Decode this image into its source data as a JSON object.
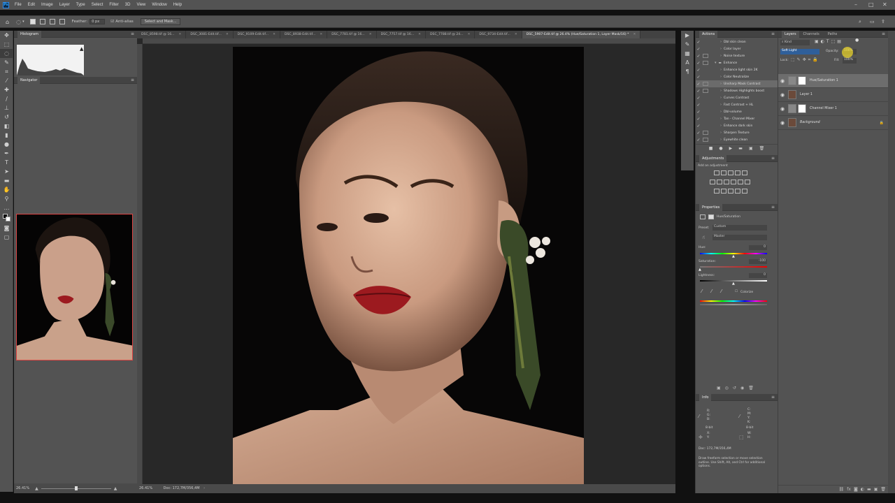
{
  "app": {
    "logo": "Ps",
    "menu": [
      "File",
      "Edit",
      "Image",
      "Layer",
      "Type",
      "Select",
      "Filter",
      "3D",
      "View",
      "Window",
      "Help"
    ],
    "window_controls": [
      "–",
      "□",
      "✕"
    ]
  },
  "options_bar": {
    "feather_label": "Feather:",
    "feather_value": "0 px",
    "antialias_label": "Anti-alias",
    "select_mask_button": "Select and Mask..."
  },
  "left_panels": {
    "histogram_tab": "Histogram",
    "navigator_tab": "Navigator",
    "zoom_value": "26.41%"
  },
  "doc_tabs": [
    {
      "label": "DSC_8598.tif @ 16...",
      "active": false
    },
    {
      "label": "DSC_3081-Edit.tif...",
      "active": false
    },
    {
      "label": "DSC_9109-Edit.tif...",
      "active": false
    },
    {
      "label": "DSC_8938-Edit.tif...",
      "active": false
    },
    {
      "label": "DSC_7781.tif @ 16...",
      "active": false
    },
    {
      "label": "DSC_7757.tif @ 16...",
      "active": false
    },
    {
      "label": "DSC_7788.tif @ 24...",
      "active": false
    },
    {
      "label": "DSC_9734-Edit.tif...",
      "active": false
    },
    {
      "label": "DSC_5907-Edit.tif @ 26.4% (Hue/Saturation 1, Layer Mask/16) *",
      "active": true
    }
  ],
  "status": {
    "zoom": "26.41%",
    "doc_size": "Doc: 172,7M/356,4M"
  },
  "actions_panel": {
    "title": "Actions",
    "rows": [
      {
        "label": "Dbl skin clean",
        "checked": true,
        "dialog": false,
        "selected": false
      },
      {
        "label": "Color layer",
        "checked": true,
        "dialog": false,
        "selected": false
      },
      {
        "label": "Noise texture",
        "checked": true,
        "dialog": true,
        "selected": false
      },
      {
        "label": "Enhance",
        "checked": true,
        "dialog": true,
        "selected": false
      },
      {
        "label": "Enhance light skin 2K",
        "checked": true,
        "dialog": false,
        "selected": false
      },
      {
        "label": "Color Neutralize",
        "checked": true,
        "dialog": false,
        "selected": false
      },
      {
        "label": "Unsharp Mask Contrast",
        "checked": true,
        "dialog": true,
        "selected": true
      },
      {
        "label": "Shadows Highlights boost",
        "checked": true,
        "dialog": true,
        "selected": false
      },
      {
        "label": "Curves Contrast",
        "checked": true,
        "dialog": false,
        "selected": false
      },
      {
        "label": "Fast Contrast + HL",
        "checked": true,
        "dialog": false,
        "selected": false
      },
      {
        "label": "Dbl-volume",
        "checked": true,
        "dialog": false,
        "selected": false
      },
      {
        "label": "Tan - Channel Mixer",
        "checked": true,
        "dialog": false,
        "selected": false
      },
      {
        "label": "Enhance dark skin",
        "checked": true,
        "dialog": false,
        "selected": false
      },
      {
        "label": "Sharpen Texture",
        "checked": true,
        "dialog": true,
        "selected": false
      },
      {
        "label": "Eyewhite clean",
        "checked": true,
        "dialog": true,
        "selected": false
      }
    ]
  },
  "adjustments_panel": {
    "title": "Adjustments",
    "subtitle": "Add an adjustment"
  },
  "properties_panel": {
    "title": "Properties",
    "type_label": "Hue/Saturation",
    "preset_label": "Preset:",
    "preset_value": "Custom",
    "channel_value": "Master",
    "hue_label": "Hue:",
    "hue_value": "0",
    "saturation_label": "Saturation:",
    "saturation_value": "-100",
    "lightness_label": "Lightness:",
    "lightness_value": "0",
    "colorize_label": "Colorize"
  },
  "info_panel": {
    "title": "Info",
    "rgb_labels": [
      "R:",
      "G:",
      "B:"
    ],
    "cmyk_labels": [
      "C:",
      "M:",
      "Y:",
      "K:"
    ],
    "bit_left": "8-bit",
    "bit_right": "8-bit",
    "xy_labels": [
      "X:",
      "Y:"
    ],
    "wh_labels": [
      "W:",
      "H:"
    ],
    "doc_size": "Doc: 172,7M/356,4M",
    "hint": "Draw freeform selection or move selection outline. Use Shift, Alt, and Ctrl for additional options."
  },
  "layers_panel": {
    "tabs": [
      "Layers",
      "Channels",
      "Paths"
    ],
    "kind_label": "Kind",
    "blend_mode": "Soft Light",
    "opacity_label": "Opacity:",
    "opacity_value": "100%",
    "lock_label": "Lock:",
    "fill_label": "Fill:",
    "fill_value": "100%",
    "layers": [
      {
        "name": "Hue/Saturation 1",
        "selected": true,
        "italic": false
      },
      {
        "name": "Layer 1",
        "selected": false,
        "italic": false
      },
      {
        "name": "Channel Mixer 1",
        "selected": false,
        "italic": false
      },
      {
        "name": "Background",
        "selected": false,
        "italic": true
      }
    ]
  }
}
